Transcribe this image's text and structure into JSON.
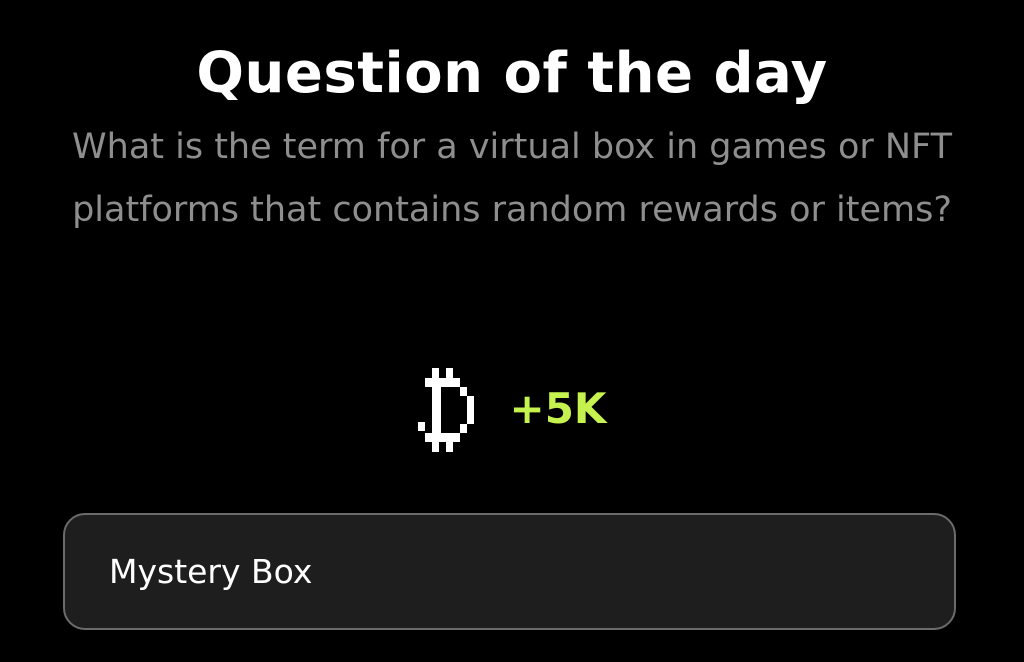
{
  "header": {
    "title": "Question of the day"
  },
  "question": {
    "text": "What is the term for a virtual box in games or NFT platforms that contains random rewards or items?"
  },
  "reward": {
    "icon": "pixel-currency-icon",
    "amount": "+5K",
    "accent_color": "#c6f24f"
  },
  "answer": {
    "value": "Mystery Box"
  }
}
